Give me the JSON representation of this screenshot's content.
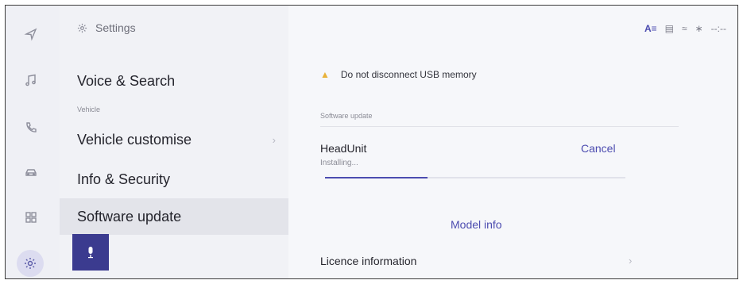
{
  "rail": {
    "items": [
      {
        "icon": "navigation-icon"
      },
      {
        "icon": "music-icon"
      },
      {
        "icon": "phone-icon"
      },
      {
        "icon": "car-icon"
      },
      {
        "icon": "apps-grid-icon"
      },
      {
        "icon": "settings-gear-icon",
        "active": true
      }
    ]
  },
  "menu": {
    "title": "Settings",
    "items": [
      {
        "label": "Voice & Search"
      },
      {
        "label": "Vehicle customise"
      },
      {
        "label": "Info & Security"
      },
      {
        "label": "Software update",
        "selected": true
      }
    ],
    "section_vehicle": "Vehicle"
  },
  "status_bar": {
    "az_label": "A≡",
    "time": "--:--"
  },
  "content": {
    "warning": "Do not disconnect USB memory",
    "software_update_label": "Software update",
    "unit_name": "HeadUnit",
    "unit_status": "Installing...",
    "cancel_label": "Cancel",
    "progress": 0.34,
    "model_info_label": "Model info",
    "licence_label": "Licence information"
  },
  "colors": {
    "accent": "#4c4cb0",
    "mic_button": "#3b3b8f",
    "warning": "#e8b23a"
  }
}
